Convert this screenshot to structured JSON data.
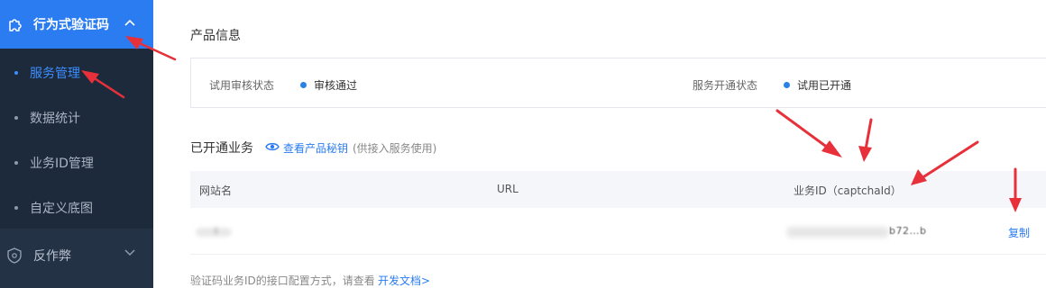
{
  "sidebar": {
    "group1_title": "行为式验证码",
    "items": [
      {
        "label": "服务管理",
        "active": true
      },
      {
        "label": "数据统计",
        "active": false
      },
      {
        "label": "业务ID管理",
        "active": false
      },
      {
        "label": "自定义底图",
        "active": false
      }
    ],
    "group2_title": "反作弊"
  },
  "product_info": {
    "title": "产品信息",
    "trial_review_label": "试用审核状态",
    "trial_review_value": "审核通过",
    "service_status_label": "服务开通状态",
    "service_status_value": "试用已开通"
  },
  "business": {
    "title": "已开通业务",
    "view_key_link": "查看产品秘钥",
    "view_key_note": "(供接入服务使用)",
    "columns": [
      "网站名",
      "URL",
      "业务ID（captchaId）"
    ],
    "row": {
      "site_name": "i",
      "url": "",
      "captcha_id": "b72…b",
      "copy_label": "复制"
    }
  },
  "footer": {
    "text": "验证码业务ID的接口配置方式，请查看",
    "link": "开发文档>"
  },
  "colors": {
    "accent": "#2a7cf0",
    "sidebar_bg": "#1d2a3c",
    "annotation_arrow": "#e8303a"
  }
}
